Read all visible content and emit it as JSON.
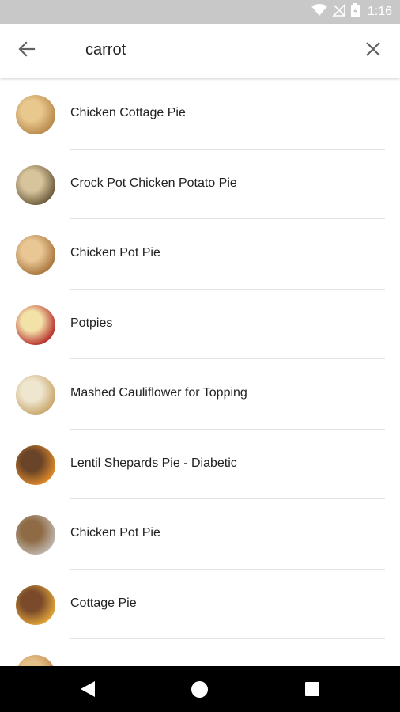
{
  "status_bar": {
    "time": "1:16",
    "icons": [
      "wifi-icon",
      "signal-off-icon",
      "battery-icon"
    ]
  },
  "search": {
    "query": "carrot",
    "back_icon": "arrow-back-icon",
    "clear_icon": "close-icon"
  },
  "results": [
    {
      "title": "Chicken Cottage Pie",
      "thumb_colors": [
        "#b7874a",
        "#e9c88e"
      ]
    },
    {
      "title": "Crock Pot Chicken Potato Pie",
      "thumb_colors": [
        "#6b5a3a",
        "#d8c49c"
      ]
    },
    {
      "title": "Chicken Pot Pie",
      "thumb_colors": [
        "#a9743c",
        "#e8c795"
      ]
    },
    {
      "title": "Potpies",
      "thumb_colors": [
        "#b52a2a",
        "#f3e2a8"
      ]
    },
    {
      "title": "Mashed Cauliflower for Topping",
      "thumb_colors": [
        "#c8a66a",
        "#efe6d0"
      ]
    },
    {
      "title": "Lentil Shepards Pie - Diabetic",
      "thumb_colors": [
        "#e08a2a",
        "#6a4428"
      ]
    },
    {
      "title": "Chicken Pot Pie",
      "thumb_colors": [
        "#c0b6ad",
        "#8e6b45"
      ]
    },
    {
      "title": "Cottage Pie",
      "thumb_colors": [
        "#e3a63a",
        "#7a4a2a"
      ]
    },
    {
      "title": "",
      "thumb_colors": [
        "#c28a4e",
        "#e6c08a"
      ]
    }
  ],
  "nav_bar": {
    "back_icon": "nav-back-icon",
    "home_icon": "nav-home-icon",
    "recents_icon": "nav-recents-icon"
  }
}
